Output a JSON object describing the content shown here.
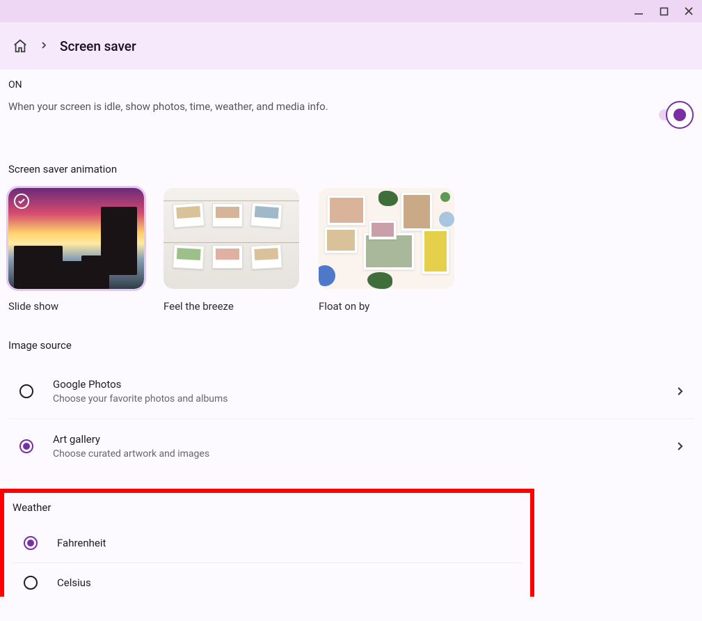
{
  "window": {
    "minimize_icon": "minimize",
    "maximize_icon": "maximize",
    "close_icon": "close"
  },
  "header": {
    "title": "Screen saver"
  },
  "status": {
    "label": "ON",
    "description": "When your screen is idle, show photos, time, weather, and media info.",
    "toggled": true
  },
  "animation": {
    "section_title": "Screen saver animation",
    "options": [
      {
        "label": "Slide show",
        "selected": true
      },
      {
        "label": "Feel the breeze",
        "selected": false
      },
      {
        "label": "Float on by",
        "selected": false
      }
    ]
  },
  "image_source": {
    "section_title": "Image source",
    "options": [
      {
        "title": "Google Photos",
        "subtitle": "Choose your favorite photos and albums",
        "selected": false
      },
      {
        "title": "Art gallery",
        "subtitle": "Choose curated artwork and images",
        "selected": true
      }
    ]
  },
  "weather": {
    "section_title": "Weather",
    "options": [
      {
        "label": "Fahrenheit",
        "selected": true
      },
      {
        "label": "Celsius",
        "selected": false
      }
    ]
  }
}
